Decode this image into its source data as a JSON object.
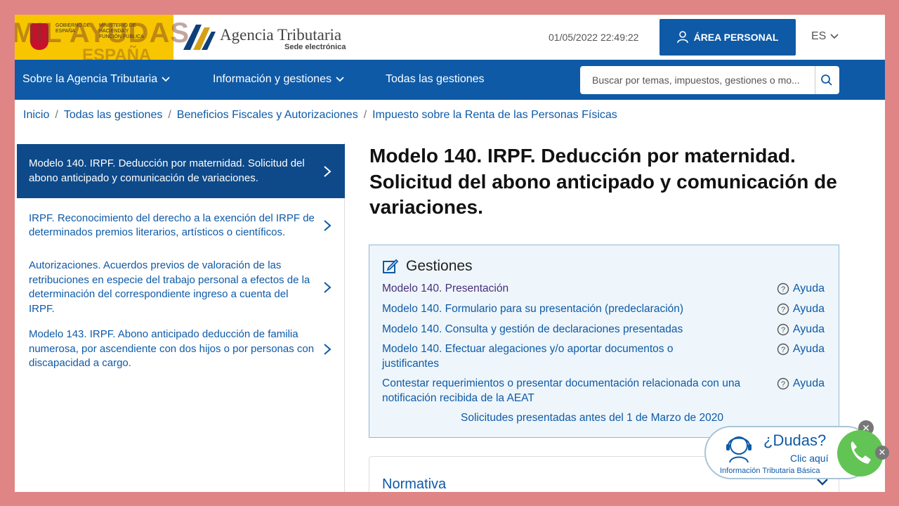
{
  "header": {
    "gov_text": "GOBIERNO DE ESPAÑA",
    "ministry_text": "MINISTERIO DE HACIENDA Y FUNCIÓN PÚBLICA",
    "watermark_top": "MIL AYUDAS",
    "watermark_bottom": "ESPAÑA",
    "agency_title": "Agencia Tributaria",
    "agency_subtitle": "Sede electrónica",
    "datetime": "01/05/2022 22:49:22",
    "area_button": "ÁREA PERSONAL",
    "language": "ES"
  },
  "nav": {
    "items": [
      {
        "label": "Sobre la Agencia Tributaria"
      },
      {
        "label": "Información y gestiones"
      },
      {
        "label": "Todas las gestiones"
      }
    ],
    "search_placeholder": "Buscar por temas, impuestos, gestiones o mo..."
  },
  "breadcrumb": [
    "Inicio",
    "Todas las gestiones",
    "Beneficios Fiscales y Autorizaciones",
    "Impuesto sobre la Renta de las Personas Físicas"
  ],
  "sidebar": {
    "items": [
      {
        "label": "Modelo 140. IRPF. Deducción por maternidad. Solicitud del abono anticipado y comunicación de variaciones."
      },
      {
        "label": "IRPF. Reconocimiento del derecho a la exención del IRPF de determinados premios literarios, artísticos o científicos."
      },
      {
        "label": "Autorizaciones. Acuerdos previos de valoración de las retribuciones en especie del trabajo personal a efectos de la determinación del correspondiente ingreso a cuenta del IRPF."
      },
      {
        "label": "Modelo 143. IRPF. Abono anticipado deducción de familia numerosa, por ascendiente con dos hijos o por personas con discapacidad a cargo."
      }
    ]
  },
  "main": {
    "title": "Modelo 140. IRPF. Deducción por maternidad. Solicitud del abono anticipado y comunicación de variaciones.",
    "gestiones": {
      "heading": "Gestiones",
      "help_label": "Ayuda",
      "items": [
        {
          "label": "Modelo 140. Presentación"
        },
        {
          "label": "Modelo 140. Formulario para su presentación (predeclaración)"
        },
        {
          "label": "Modelo 140. Consulta y gestión de declaraciones presentadas"
        },
        {
          "label": "Modelo 140. Efectuar alegaciones y/o aportar documentos o justificantes"
        },
        {
          "label": "Contestar requerimientos o presentar documentación relacionada con una notificación recibida de la AEAT"
        }
      ],
      "note": "Solicitudes presentadas antes del 1 de Marzo de 2020"
    },
    "normativa": "Normativa"
  },
  "dudas": {
    "question": "¿Dudas?",
    "click": "Clic aquí",
    "info": "Información Tributaria Básica"
  },
  "colors": {
    "primary": "#0e5aa7",
    "active_sidebar": "#0e4a8a",
    "frame": "#e08585",
    "visited_link": "#4a2d7a"
  }
}
